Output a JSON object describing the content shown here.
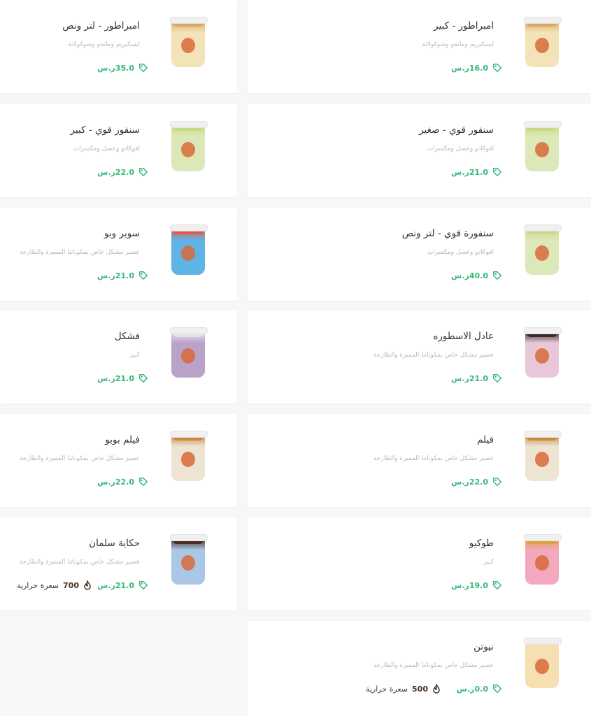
{
  "currency": "ر.س",
  "calorie_unit": "سعرة حرارية",
  "items": [
    {
      "name": "امبراطور - كبير",
      "desc": "ايسكيريم وماتجو وشوكولاتة",
      "price": "16.0",
      "body": "#f3e3b8",
      "top": "#d9a860",
      "cup": "emperor"
    },
    {
      "name": "امبراطور - لتر ونص",
      "desc": "ايسكيريم وماتجو وشوكولاتة",
      "price": "35.0",
      "body": "#f3e3b8",
      "top": "#d9a860",
      "cup": "emperor"
    },
    {
      "name": "سنفور قوي - صغير",
      "desc": "افوكادو وعسل ومكسرات",
      "price": "21.0",
      "body": "#dde8b8",
      "top": "#c9d98a",
      "cup": "green"
    },
    {
      "name": "سنفور قوي - كبير",
      "desc": "افوكادو وعسل ومكسرات",
      "price": "22.0",
      "body": "#dde8b8",
      "top": "#c9d98a",
      "cup": "green"
    },
    {
      "name": "سنفورة قوي - لتر ونص",
      "desc": "افوكادو وعسل ومكسرات",
      "price": "40.0",
      "body": "#dde8b8",
      "top": "#c9d98a",
      "cup": "green"
    },
    {
      "name": "سوبر وبو",
      "desc": "عصير مشكل خاص بمكوناتنا المميزة والطازجة",
      "price": "21.0",
      "body": "#5fb4e6",
      "top": "#e05a4a",
      "cup": "blue"
    },
    {
      "name": "عادل الاسطوره",
      "desc": "عصير مشكل خاص بمكوناتنا المميزة والطازجة",
      "price": "21.0",
      "body": "#e8c8d8",
      "top": "#3a2a2a",
      "cup": "pink"
    },
    {
      "name": "فشكل",
      "desc": "كبير",
      "price": "21.0",
      "body": "#b9a3c8",
      "top": "#e8e2ee",
      "cup": "purple"
    },
    {
      "name": "فيلم",
      "desc": "عصير مشكل خاص بمكوناتنا المميزة والطازجة",
      "price": "22.0",
      "body": "#eee4d4",
      "top": "#c88a3a",
      "cup": "film"
    },
    {
      "name": "فيلم بوبو",
      "desc": "عصير مشكل خاص بمكوناتنا المميزة والطازجة",
      "price": "22.0",
      "body": "#eee4d4",
      "top": "#c88a3a",
      "cup": "film"
    },
    {
      "name": "طوكيو",
      "desc": "كبير",
      "price": "19.0",
      "body": "#f2a9bd",
      "top": "#e0a040",
      "cup": "tokyo"
    },
    {
      "name": "حكاية سلمان",
      "desc": "عصير مشكل خاص بمكوناتنا المميزة والطازجة",
      "price": "21.0",
      "calories": "700",
      "body": "#aac8e6",
      "top": "#4a2a22",
      "cup": "salman"
    },
    {
      "name": "نيوتن",
      "desc": "عصير مشكل خاص بمكوناتنا المميزة والطازجة",
      "price": "0.0",
      "calories": "500",
      "body": "#f6dfb0",
      "top": "#f6dfb0",
      "cup": "newton"
    }
  ]
}
